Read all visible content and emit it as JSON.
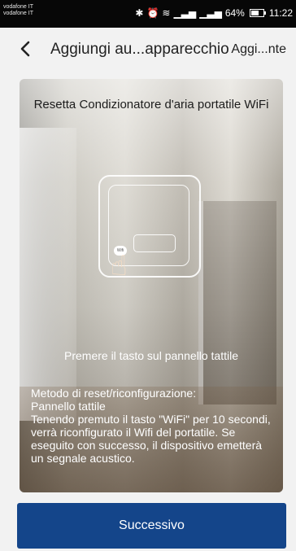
{
  "status_bar": {
    "carrier_line_1": "vodafone IT",
    "carrier_line_2": "vodafone IT",
    "battery": "64%",
    "time": "11:22"
  },
  "header": {
    "title": "Aggiungi au...apparecchio",
    "action": "Aggi...nte"
  },
  "card": {
    "heading": "Resetta Condizionatore d'aria portatile WiFi",
    "device_button_label": "Wifi",
    "instruction": "Premere il tasto sul pannello tattile",
    "method_title": "Metodo di reset/riconfigurazione:",
    "method_subtitle": "Pannello tattile",
    "method_text": "Tenendo premuto il tasto \"WiFi\" per 10 secondi, verrà riconfigurato il Wifi del portatile. Se eseguito con successo, il dispositivo emetterà un segnale acustico."
  },
  "footer": {
    "next_label": "Successivo"
  }
}
